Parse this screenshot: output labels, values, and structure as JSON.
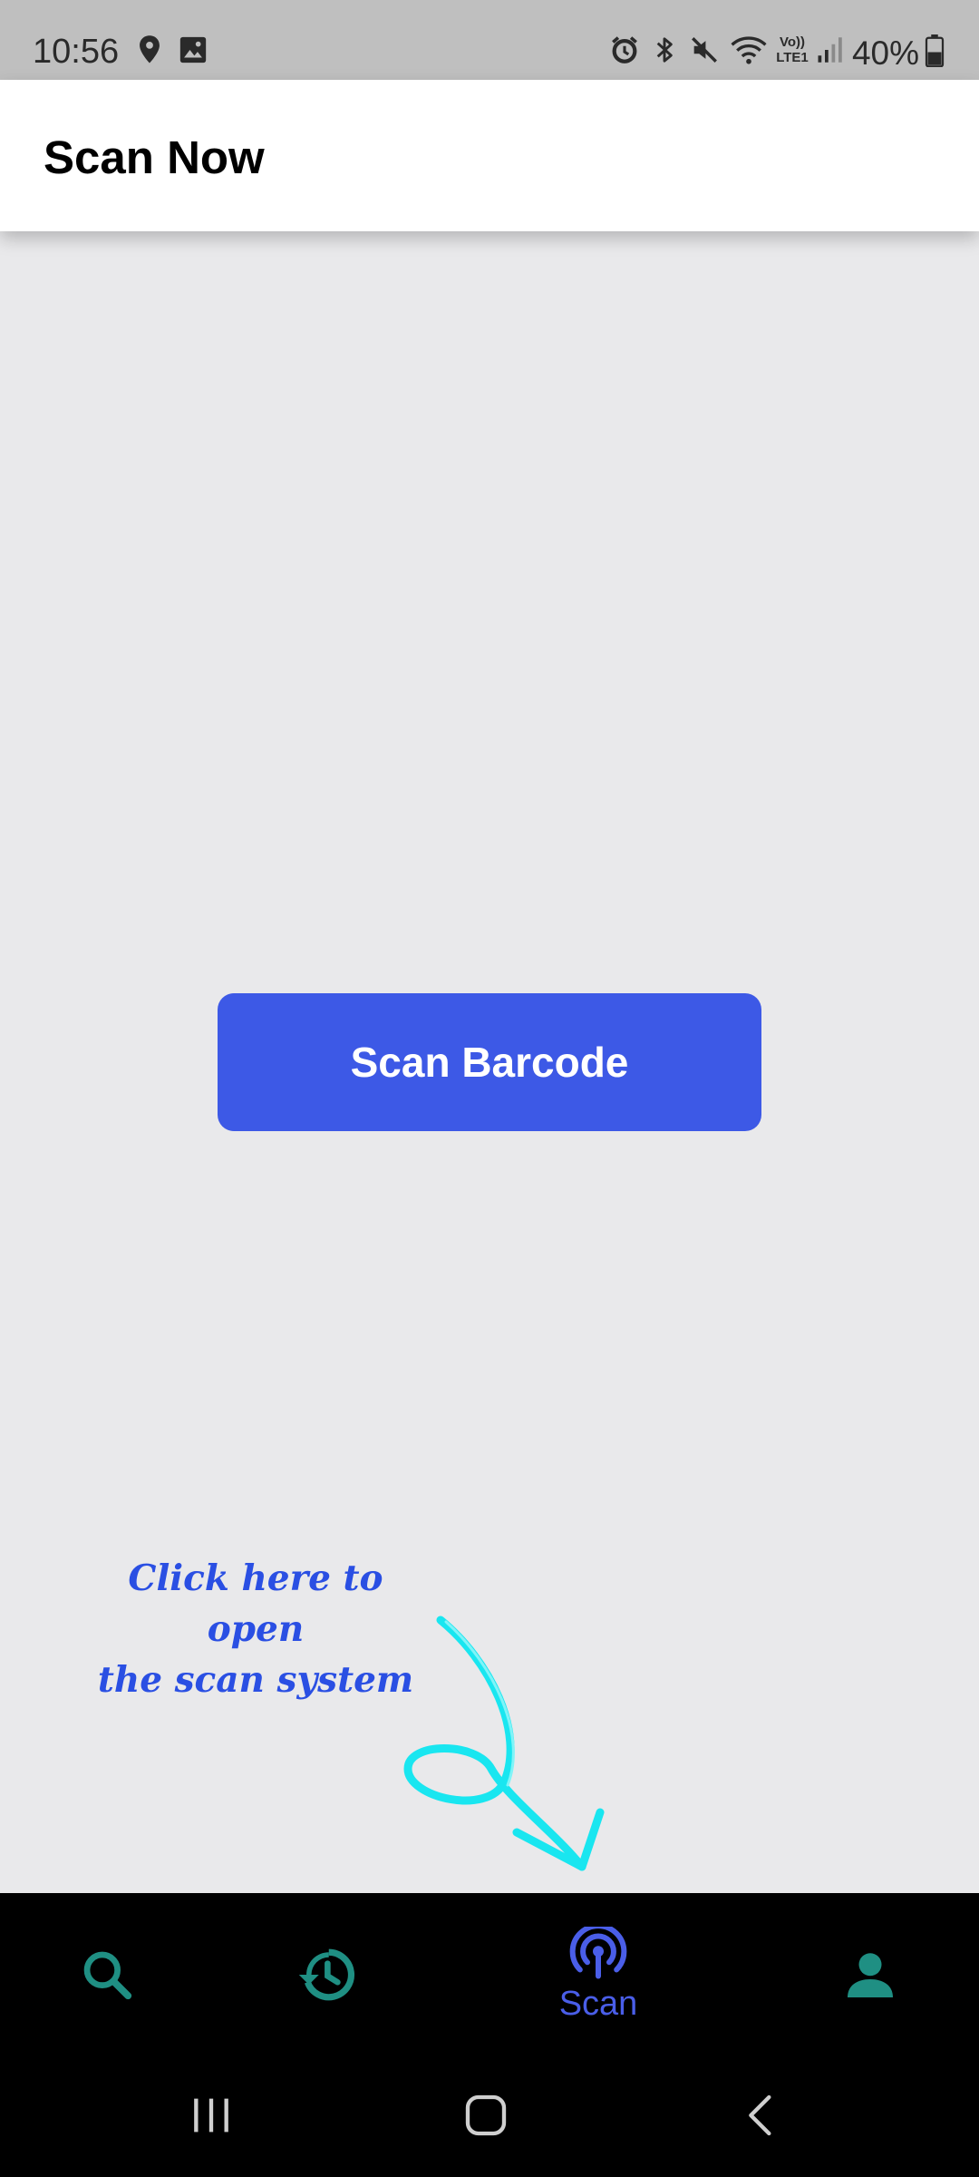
{
  "status_bar": {
    "time": "10:56",
    "battery_percent": "40%",
    "icons": [
      "location-icon",
      "gallery-icon",
      "alarm-icon",
      "bluetooth-icon",
      "mute-icon",
      "wifi-icon",
      "volte-icon",
      "signal-icon",
      "battery-icon"
    ],
    "volte_label_top": "Vo))",
    "volte_label_bottom": "LTE1"
  },
  "app_bar": {
    "title": "Scan Now"
  },
  "main": {
    "scan_button_label": "Scan Barcode"
  },
  "annotation": {
    "line1": "Click here to open",
    "line2": "the scan system"
  },
  "bottom_nav": {
    "items": [
      {
        "icon": "search-icon",
        "label": ""
      },
      {
        "icon": "history-icon",
        "label": ""
      },
      {
        "icon": "scan-radar-icon",
        "label": "Scan",
        "active": true
      },
      {
        "icon": "profile-icon",
        "label": ""
      }
    ],
    "active_color": "#4a5ee8",
    "inactive_color": "#1f8f83"
  },
  "system_nav": {
    "buttons": [
      "recent-apps",
      "home",
      "back"
    ]
  },
  "colors": {
    "primary": "#3d59e6",
    "background": "#e9e9eb",
    "annotation_text": "#2a4fe3",
    "annotation_arrow": "#19e6f0"
  }
}
